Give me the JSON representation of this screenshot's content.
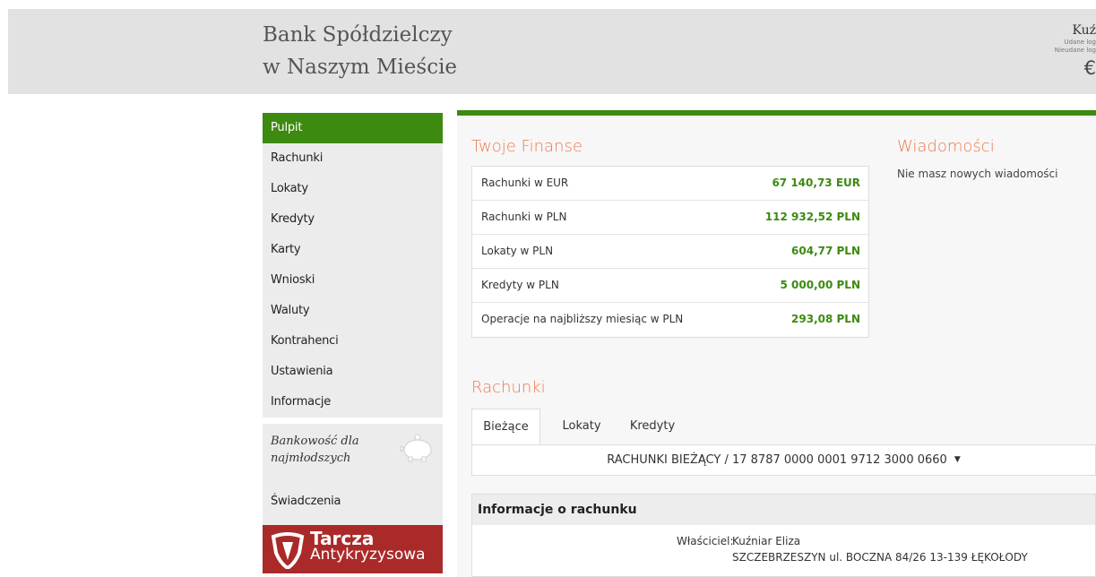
{
  "header": {
    "bank_line1": "Bank Spółdzielczy",
    "bank_line2": "w Naszym Mieście",
    "user_name": "Kuź",
    "login_ok": "Udane log",
    "login_fail": "Nieudane log",
    "currency_icon": "euro-icon",
    "currency_symbol": "€"
  },
  "sidebar": {
    "items": [
      {
        "label": "Pulpit",
        "active": true
      },
      {
        "label": "Rachunki"
      },
      {
        "label": "Lokaty"
      },
      {
        "label": "Kredyty"
      },
      {
        "label": "Karty"
      },
      {
        "label": "Wnioski"
      },
      {
        "label": "Waluty"
      },
      {
        "label": "Kontrahenci"
      },
      {
        "label": "Ustawienia"
      },
      {
        "label": "Informacje"
      }
    ],
    "kids_line1": "Bankowość dla",
    "kids_line2": "najmłodszych",
    "benefits": "Świadczenia",
    "tarcza_title": "Tarcza",
    "tarcza_sub": "Antykryzysowa"
  },
  "finances": {
    "title": "Twoje Finanse",
    "rows": [
      {
        "label": "Rachunki w EUR",
        "value": "67 140,73 EUR"
      },
      {
        "label": "Rachunki w PLN",
        "value": "112 932,52 PLN"
      },
      {
        "label": "Lokaty w PLN",
        "value": "604,77 PLN"
      },
      {
        "label": "Kredyty w PLN",
        "value": "5 000,00 PLN"
      },
      {
        "label": "Operacje na najbliższy miesiąc w PLN",
        "value": "293,08 PLN"
      }
    ]
  },
  "messages": {
    "title": "Wiadomości",
    "text": "Nie masz nowych wiadomości"
  },
  "accounts": {
    "title": "Rachunki",
    "tabs": [
      "Bieżące",
      "Lokaty",
      "Kredyty"
    ],
    "selected_account": "RACHUNKI BIEŻĄCY / 17 8787 0000 0001 9712 3000 0660"
  },
  "account_info": {
    "title": "Informacje o rachunku",
    "owner_label": "Właściciel:",
    "owner_name": "Kuźniar Eliza",
    "owner_address": "SZCZEBRZESZYN ul. BOCZNA 84/26 13-139 ŁĘKOŁODY"
  },
  "colors": {
    "accent_green": "#3c8a10",
    "section_title_orange": "#ec7a4f",
    "tarcza_red": "#aa2a2a"
  }
}
